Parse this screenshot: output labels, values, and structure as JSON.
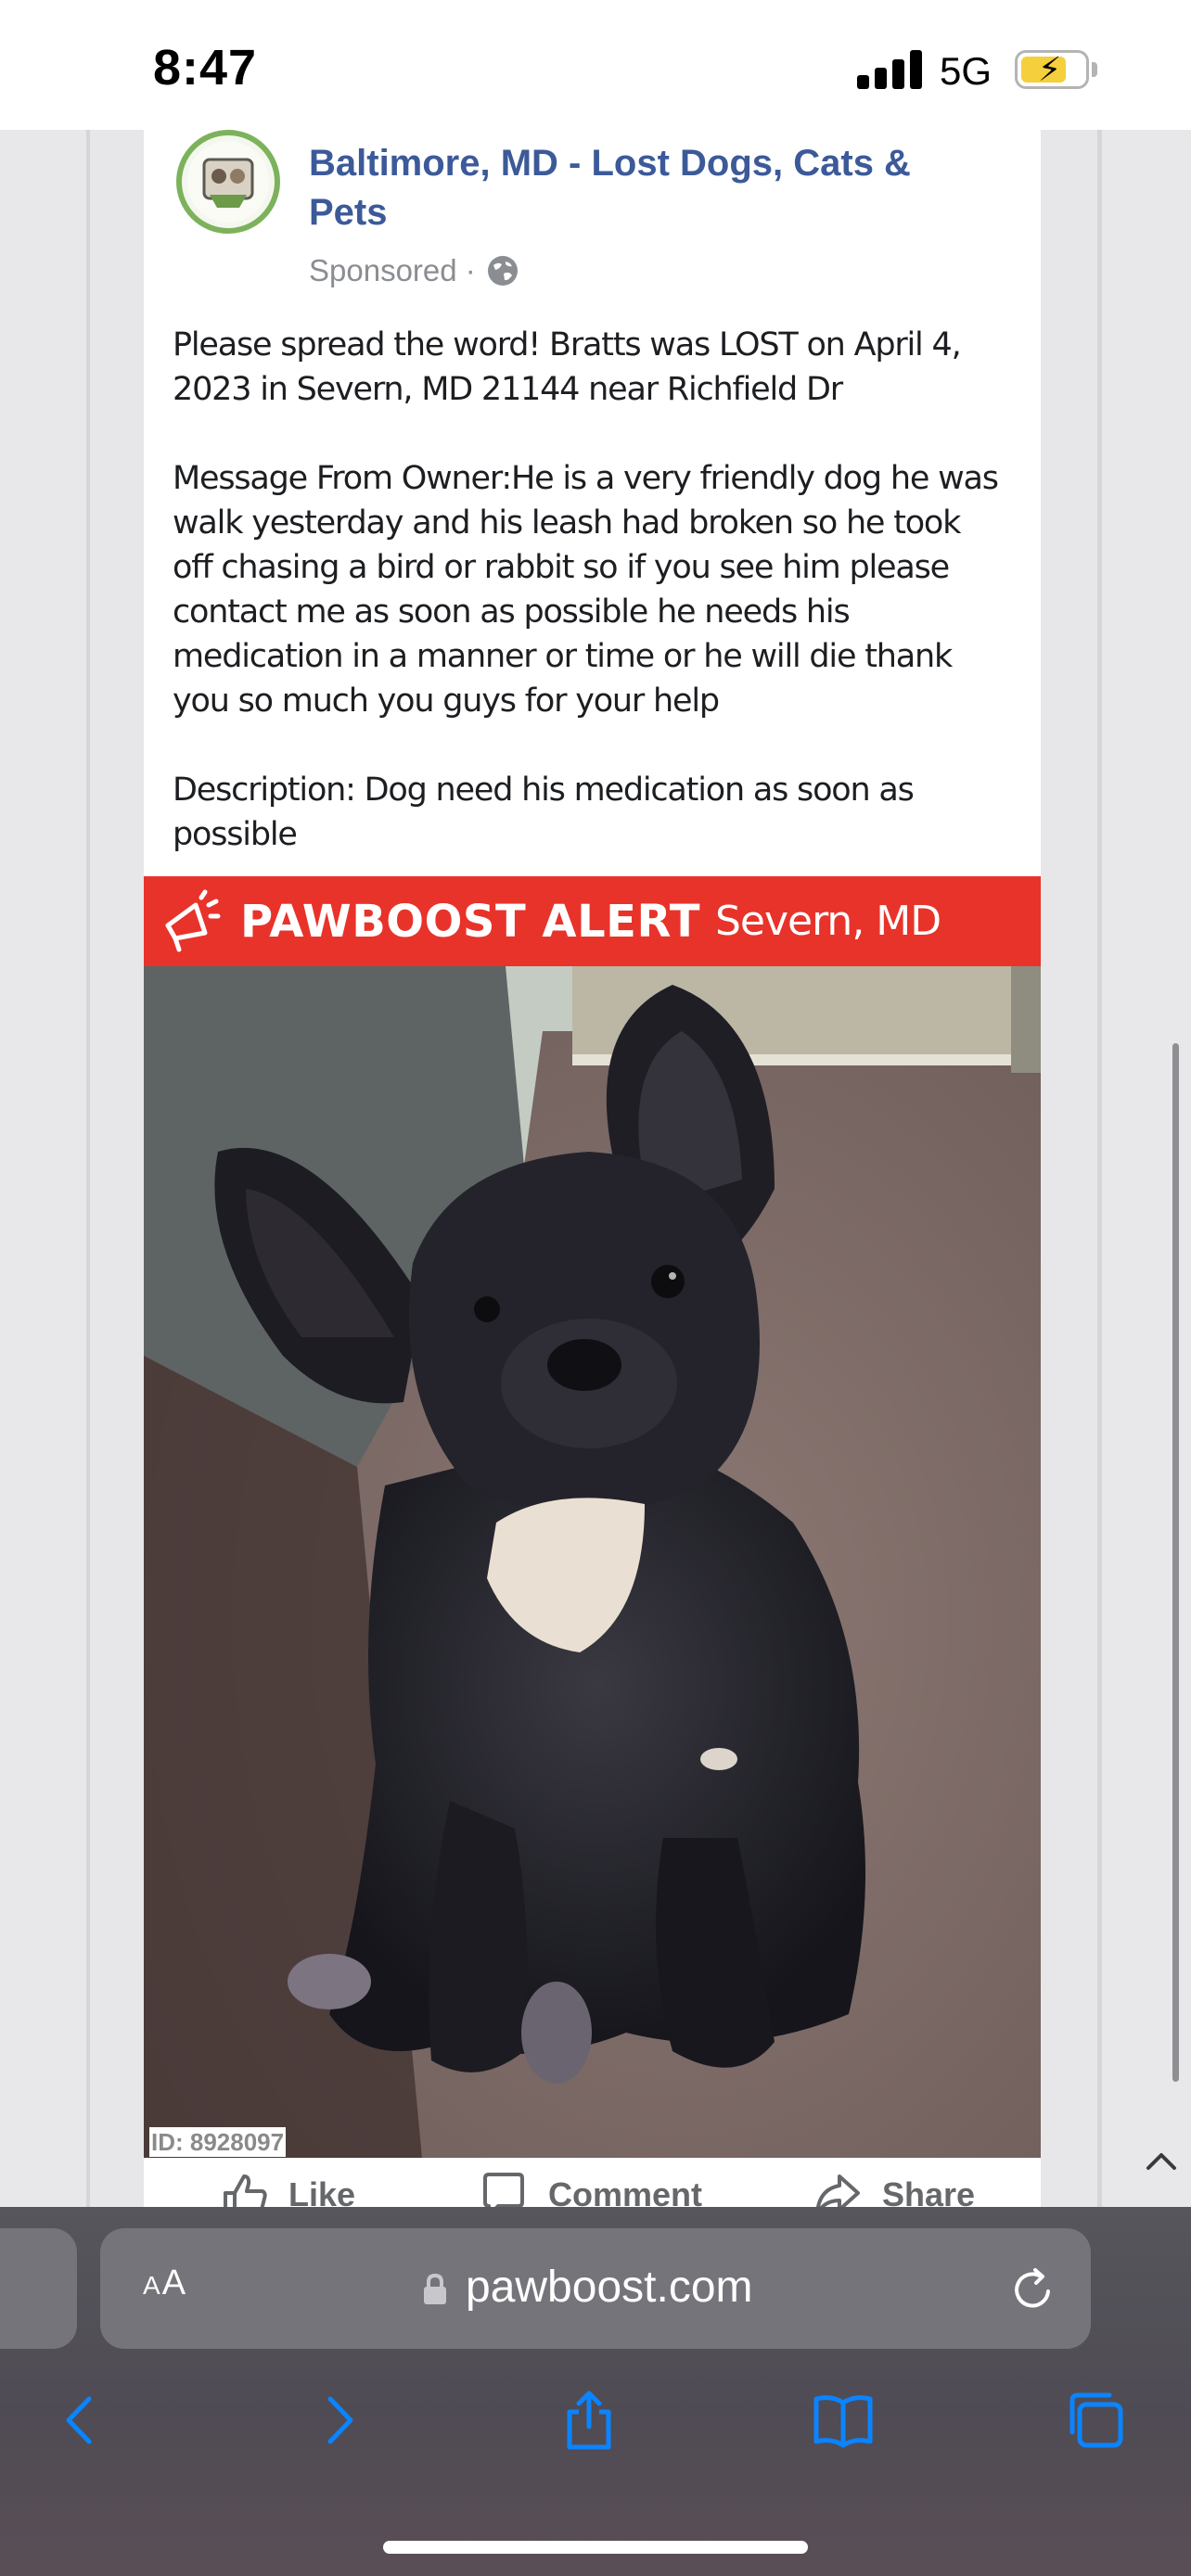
{
  "status_bar": {
    "time": "8:47",
    "network": "5G"
  },
  "post": {
    "group_name": "Baltimore, MD - Lost Dogs, Cats & Pets",
    "sponsored": "Sponsored ·",
    "paragraphs": [
      "Please spread the word! Bratts was LOST on April 4, 2023 in Severn, MD 21144 near Richfield Dr",
      "Message From Owner:He is a very friendly dog he was walk yesterday and his leash had broken so he took off chasing a bird or rabbit so if you see him please contact me as soon as possible he needs his medication in a manner or time or he will die thank you so much you guys for your help",
      "Description: Dog need his medication as soon as possible"
    ],
    "alert": {
      "title": "PAWBOOST ALERT",
      "location": "Severn, MD"
    },
    "photo_id": "ID: 8928097",
    "actions": {
      "like": "Like",
      "comment": "Comment",
      "share": "Share"
    }
  },
  "browser": {
    "aa_label_small": "A",
    "aa_label_large": "A",
    "url": "pawboost.com"
  },
  "colors": {
    "link_blue": "#3c5a99",
    "alert_red": "#e8332a",
    "icon_blue": "#0a84ff",
    "battery_yellow": "#f5cf3c"
  },
  "icons": {
    "status": [
      "signal-icon",
      "battery-icon"
    ],
    "post": [
      "group-avatar",
      "globe-icon",
      "megaphone-icon"
    ],
    "toolbar": [
      "back-icon",
      "forward-icon",
      "share-icon",
      "bookmarks-icon",
      "tabs-icon"
    ]
  }
}
